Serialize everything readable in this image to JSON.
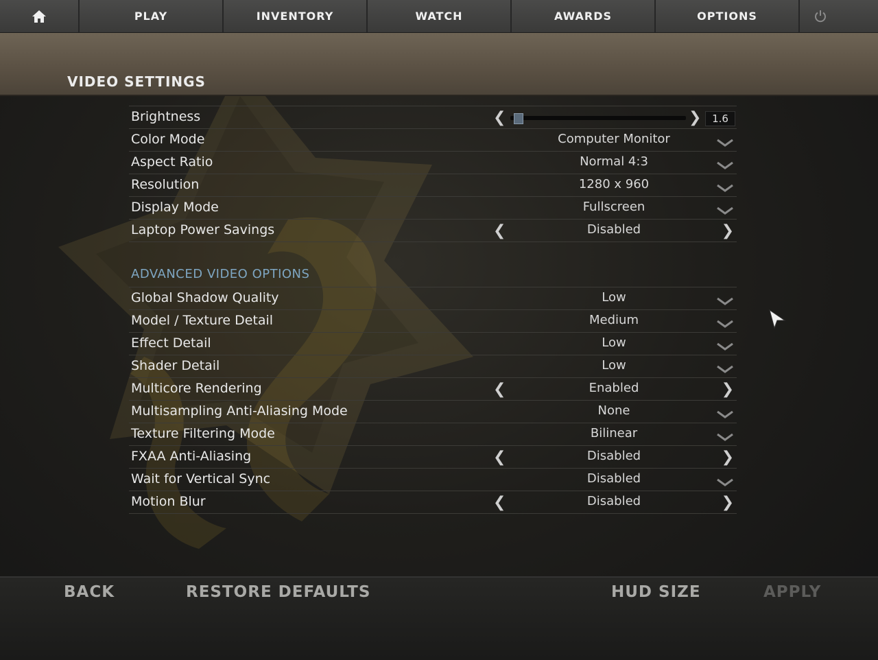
{
  "nav": {
    "home_icon": "home-icon",
    "items": [
      "PLAY",
      "INVENTORY",
      "WATCH",
      "AWARDS",
      "OPTIONS"
    ],
    "power_icon": "power-icon"
  },
  "page_title": "VIDEO SETTINGS",
  "brightness": {
    "label": "Brightness",
    "value": "1.6",
    "fraction": 0.02
  },
  "basic_settings": [
    {
      "label": "Color Mode",
      "value": "Computer Monitor",
      "control": "dropdown"
    },
    {
      "label": "Aspect Ratio",
      "value": "Normal 4:3",
      "control": "dropdown"
    },
    {
      "label": "Resolution",
      "value": "1280 x 960",
      "control": "dropdown"
    },
    {
      "label": "Display Mode",
      "value": "Fullscreen",
      "control": "dropdown"
    },
    {
      "label": "Laptop Power Savings",
      "value": "Disabled",
      "control": "toggle"
    }
  ],
  "advanced_section_label": "ADVANCED VIDEO OPTIONS",
  "advanced_settings": [
    {
      "label": "Global Shadow Quality",
      "value": "Low",
      "control": "dropdown"
    },
    {
      "label": "Model / Texture Detail",
      "value": "Medium",
      "control": "dropdown"
    },
    {
      "label": "Effect Detail",
      "value": "Low",
      "control": "dropdown"
    },
    {
      "label": "Shader Detail",
      "value": "Low",
      "control": "dropdown"
    },
    {
      "label": "Multicore Rendering",
      "value": "Enabled",
      "control": "toggle"
    },
    {
      "label": "Multisampling Anti-Aliasing Mode",
      "value": "None",
      "control": "dropdown"
    },
    {
      "label": "Texture Filtering Mode",
      "value": "Bilinear",
      "control": "dropdown"
    },
    {
      "label": "FXAA Anti-Aliasing",
      "value": "Disabled",
      "control": "toggle"
    },
    {
      "label": "Wait for Vertical Sync",
      "value": "Disabled",
      "control": "dropdown"
    },
    {
      "label": "Motion Blur",
      "value": "Disabled",
      "control": "toggle"
    }
  ],
  "footer": {
    "back": "BACK",
    "restore_defaults": "RESTORE DEFAULTS",
    "hud_size": "HUD SIZE",
    "apply": "APPLY"
  },
  "colors": {
    "section_accent": "#7ea6c2",
    "nav_bg": "#3f3f3e",
    "header_band": "#5e5446"
  }
}
